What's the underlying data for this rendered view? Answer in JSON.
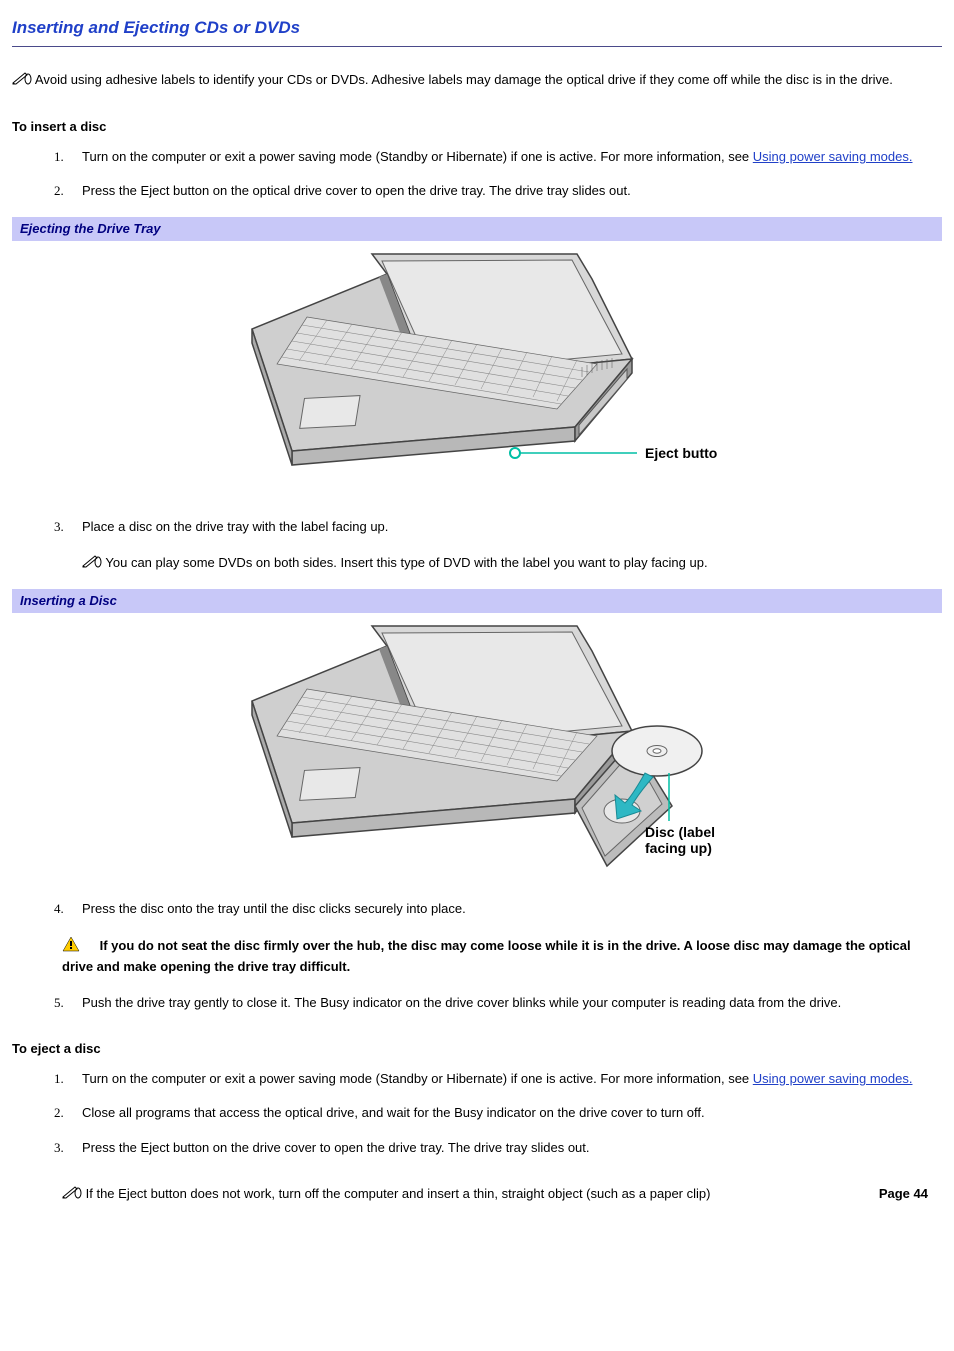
{
  "title": "Inserting and Ejecting CDs or DVDs",
  "intro_note": "Avoid using adhesive labels to identify your CDs or DVDs. Adhesive labels may damage the optical drive if they come off while the disc is in the drive.",
  "insert_heading": "To insert a disc",
  "insert_steps": {
    "1a": "Turn on the computer or exit a power saving mode (Standby or Hibernate) if one is active. For more information, see ",
    "1_link": "Using power saving modes.",
    "2": "Press the Eject button on the optical drive cover to open the drive tray. The drive tray slides out.",
    "3": "Place a disc on the drive tray with the label facing up.",
    "3_note": "You can play some DVDs on both sides. Insert this type of DVD with the label you want to play facing up.",
    "4": "Press the disc onto the tray until the disc clicks securely into place.",
    "4_warning": "If you do not seat the disc firmly over the hub, the disc may come loose while it is in the drive. A loose disc may damage the optical drive and make opening the drive tray difficult.",
    "5": "Push the drive tray gently to close it. The Busy indicator on the drive cover blinks while your computer is reading data from the drive."
  },
  "fig1_caption": "Ejecting the Drive Tray",
  "fig1_label": "Eject button",
  "fig2_caption": "Inserting a Disc",
  "fig2_label1": "Disc (label",
  "fig2_label2": "facing up)",
  "eject_heading": "To eject a disc",
  "eject_steps": {
    "1a": "Turn on the computer or exit a power saving mode (Standby or Hibernate) if one is active. For more information, see ",
    "1_link": "Using power saving modes.",
    "2": "Close all programs that access the optical drive, and wait for the Busy indicator on the drive cover to turn off.",
    "3": "Press the Eject button on the drive cover to open the drive tray. The drive tray slides out.",
    "3_note": "If the Eject button does not work, turn off the computer and insert a thin, straight object (such as a paper clip)"
  },
  "page_number": "Page 44"
}
